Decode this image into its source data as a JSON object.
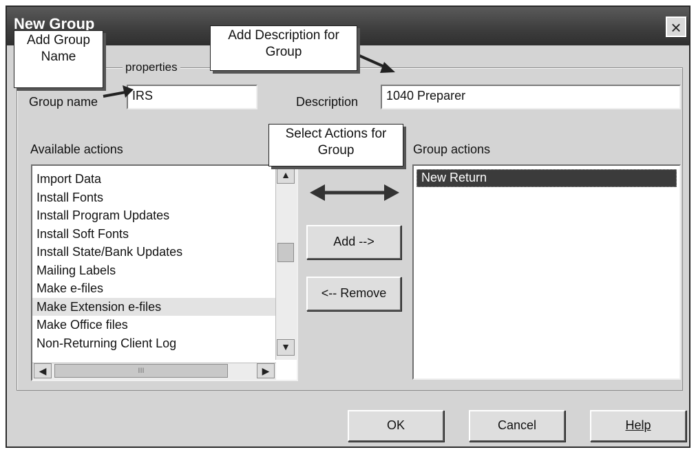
{
  "dialog": {
    "title": "New Group",
    "close_label": "×"
  },
  "groupbox": {
    "legend": "properties"
  },
  "fields": {
    "group_name_label": "Group name",
    "group_name_value": "IRS",
    "description_label": "Description",
    "description_value": "1040 Preparer"
  },
  "available": {
    "label": "Available actions",
    "items": [
      "Import Data",
      "Install Fonts",
      "Install Program Updates",
      "Install Soft Fonts",
      "Install State/Bank Updates",
      "Mailing Labels",
      "Make e-files",
      "Make Extension e-files",
      "Make Office files",
      "Non-Returning Client Log"
    ],
    "hovered_item": "Make Extension e-files"
  },
  "group_actions": {
    "label": "Group actions",
    "items": [
      "New Return"
    ],
    "selected_item": "New Return"
  },
  "buttons": {
    "add": "Add -->",
    "remove": "<-- Remove",
    "ok": "OK",
    "cancel": "Cancel",
    "help": "Help"
  },
  "scrollbar_glyphs": {
    "up": "▲",
    "down": "▼",
    "left": "◀",
    "right": "▶",
    "grip": "III"
  },
  "callouts": {
    "group_name": "Add Group Name",
    "description": "Add Description for Group",
    "actions": "Select Actions for Group"
  }
}
